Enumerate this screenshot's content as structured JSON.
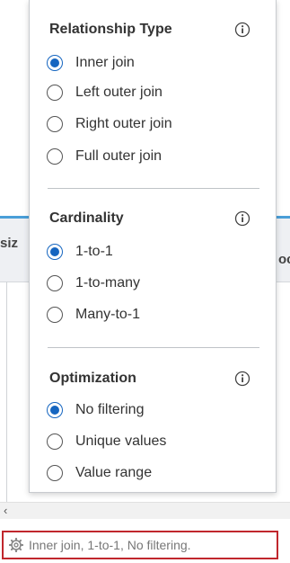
{
  "background": {
    "left_fragment": "siz",
    "right_fragment": "oc",
    "scroll_left_glyph": "‹"
  },
  "popover": {
    "relationship": {
      "title": "Relationship Type",
      "info_icon": "info-icon",
      "options": [
        {
          "label": "Inner join",
          "checked": true
        },
        {
          "label": "Left outer join",
          "checked": false
        },
        {
          "label": "Right outer join",
          "checked": false
        },
        {
          "label": "Full outer join",
          "checked": false
        }
      ]
    },
    "cardinality": {
      "title": "Cardinality",
      "info_icon": "info-icon",
      "options": [
        {
          "label": "1-to-1",
          "checked": true
        },
        {
          "label": "1-to-many",
          "checked": false
        },
        {
          "label": "Many-to-1",
          "checked": false
        }
      ]
    },
    "optimization": {
      "title": "Optimization",
      "info_icon": "info-icon",
      "options": [
        {
          "label": "No filtering",
          "checked": true
        },
        {
          "label": "Unique values",
          "checked": false
        },
        {
          "label": "Value range",
          "checked": false
        }
      ]
    }
  },
  "status_bar": {
    "icon": "gear-icon",
    "text": "Inner join, 1-to-1, No filtering."
  },
  "colors": {
    "accent": "#1565c0",
    "status_border": "#c0272d",
    "header_line": "#4a9fd8"
  }
}
